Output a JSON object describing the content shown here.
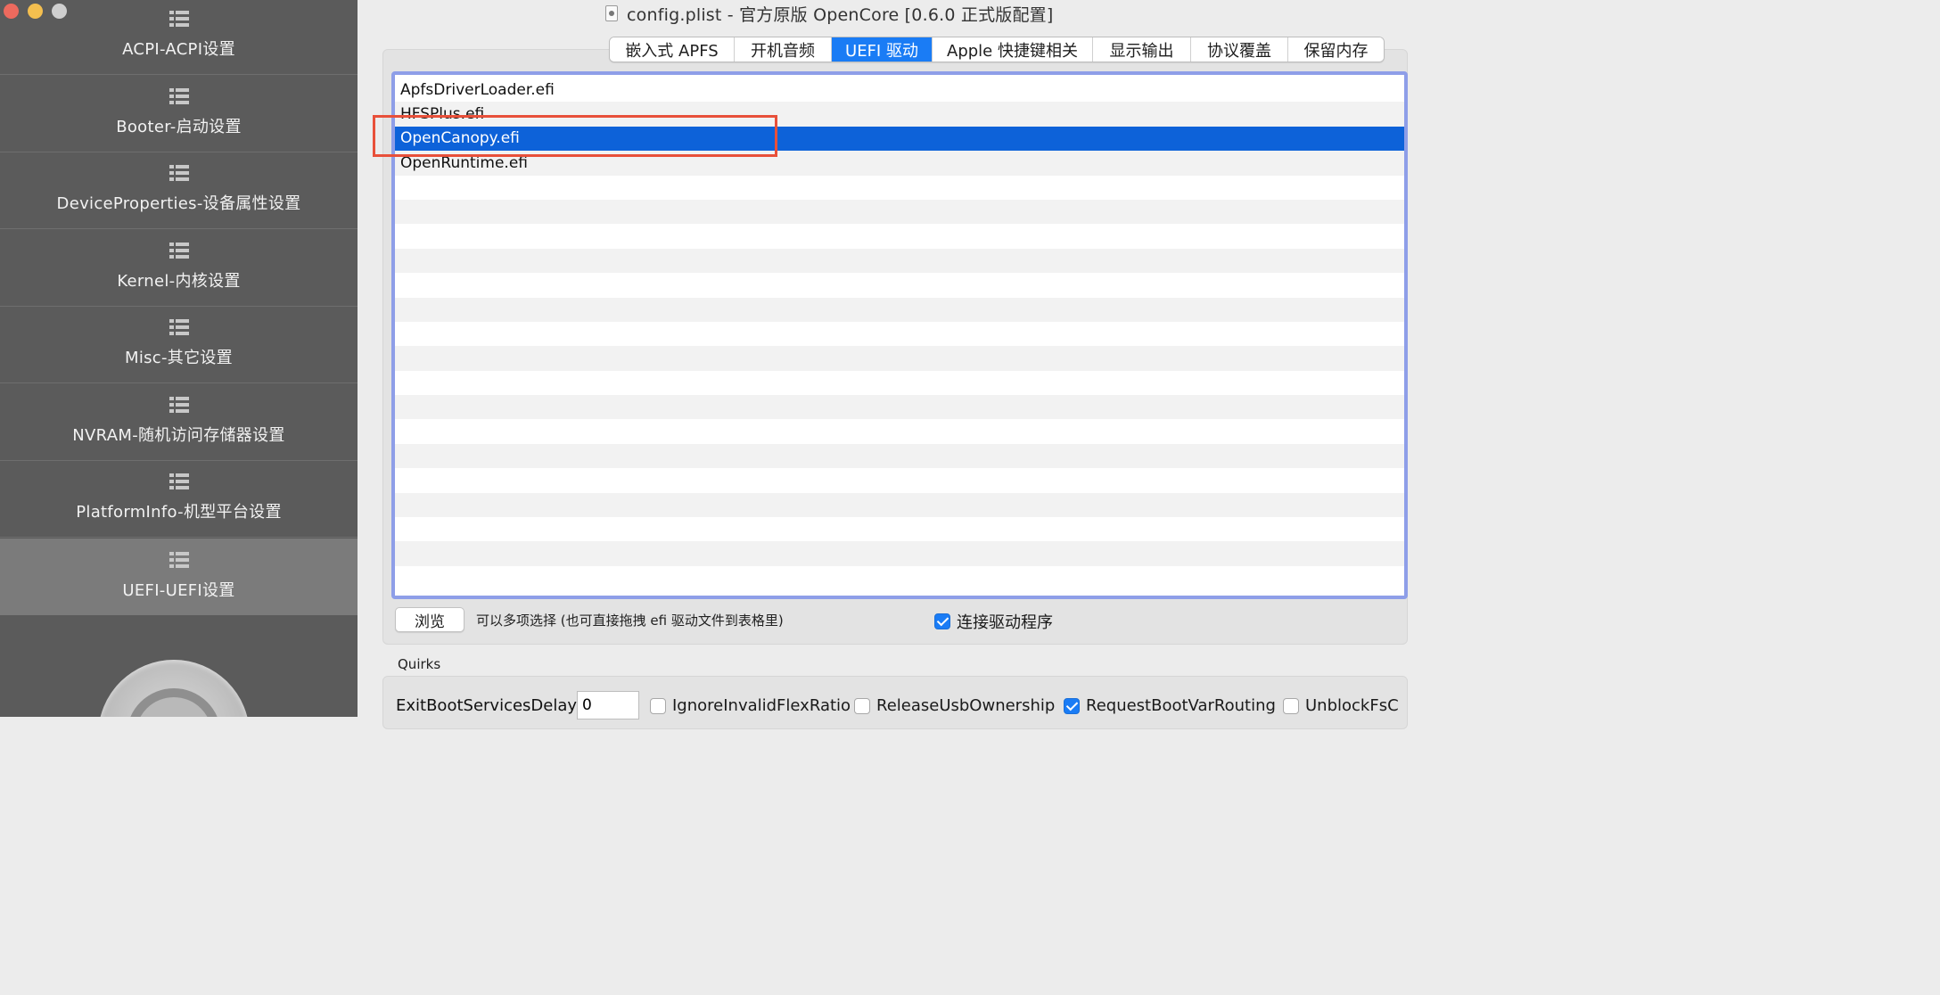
{
  "window": {
    "title": "config.plist - 官方原版 OpenCore [0.6.0 正式版配置]"
  },
  "sidebar": {
    "items": [
      {
        "label": "ACPI-ACPI设置",
        "active": false
      },
      {
        "label": "Booter-启动设置",
        "active": false
      },
      {
        "label": "DeviceProperties-设备属性设置",
        "active": false
      },
      {
        "label": "Kernel-内核设置",
        "active": false
      },
      {
        "label": "Misc-其它设置",
        "active": false
      },
      {
        "label": "NVRAM-随机访问存储器设置",
        "active": false
      },
      {
        "label": "PlatformInfo-机型平台设置",
        "active": false
      },
      {
        "label": "UEFI-UEFI设置",
        "active": true
      }
    ]
  },
  "tabs": [
    {
      "label": "嵌入式 APFS",
      "active": false
    },
    {
      "label": "开机音频",
      "active": false
    },
    {
      "label": "UEFI 驱动",
      "active": true
    },
    {
      "label": "Apple 快捷键相关",
      "active": false
    },
    {
      "label": "显示输出",
      "active": false
    },
    {
      "label": "协议覆盖",
      "active": false
    },
    {
      "label": "保留内存",
      "active": false
    }
  ],
  "drivers": {
    "items": [
      "ApfsDriverLoader.efi",
      "HFSPlus.efi",
      "OpenCanopy.efi",
      "OpenRuntime.efi"
    ],
    "selected": "OpenCanopy.efi"
  },
  "actions": {
    "browse_label": "浏览",
    "hint": "可以多项选择 (也可直接拖拽 efi 驱动文件到表格里)",
    "connect_label": "连接驱动程序",
    "connect_checked": true
  },
  "quirks": {
    "section_label": "Quirks",
    "exit_boot_services_delay_label": "ExitBootServicesDelay",
    "exit_boot_services_delay_value": "0",
    "items": [
      {
        "label": "IgnoreInvalidFlexRatio",
        "checked": false
      },
      {
        "label": "ReleaseUsbOwnership",
        "checked": false
      },
      {
        "label": "RequestBootVarRouting",
        "checked": true
      },
      {
        "label": "UnblockFsC",
        "checked": false
      }
    ]
  },
  "colors": {
    "accent": "#1a7cf5",
    "selection": "#0d62d9",
    "highlight_box": "#e8503a",
    "list_focus_ring": "#8e9ee8",
    "sidebar_bg": "#5b5b5b",
    "sidebar_active_bg": "#7b7b7b"
  },
  "icons": {
    "sidebar": "list-icon",
    "document": "document-icon",
    "settings": "gear-icon"
  }
}
